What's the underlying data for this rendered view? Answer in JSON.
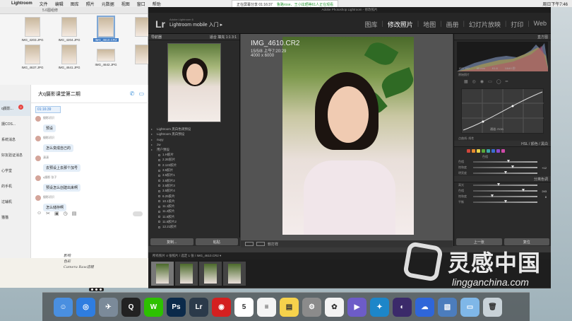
{
  "menubar": {
    "apple": "",
    "app": "Lightroom",
    "items": [
      "文件",
      "编辑",
      "图库",
      "照片",
      "元数据",
      "视图",
      "窗口",
      "帮助"
    ],
    "right": [
      "周日下午7:46"
    ]
  },
  "share_banner": {
    "text": "正在屏幕分享 01:16:37",
    "notice": "鲁路rose、王小炫晒等61人正在观看"
  },
  "finder": {
    "title": "5.6图组修",
    "thumbs": [
      {
        "name": "IMG_4203.JPG",
        "selected": false,
        "landscape": false
      },
      {
        "name": "IMG_4204.JPG",
        "selected": false,
        "landscape": false
      },
      {
        "name": "IMG_4610.CR2",
        "selected": true,
        "landscape": false
      },
      {
        "name": "",
        "selected": false,
        "landscape": false
      },
      {
        "name": "IMG_4637.JPG",
        "selected": false,
        "landscape": false
      },
      {
        "name": "IMG_4641.JPG",
        "selected": false,
        "landscape": false
      },
      {
        "name": "IMG_4642.JPG",
        "selected": false,
        "landscape": true
      },
      {
        "name": "",
        "selected": false,
        "landscape": false
      }
    ]
  },
  "chat": {
    "sidebar": [
      {
        "label": "",
        "badge": ""
      },
      {
        "label": "q摄影...",
        "badge": "2",
        "active": true
      },
      {
        "label": "摄COS...",
        "badge": "",
        "active": false
      },
      {
        "label": "系统消息",
        "badge": ""
      },
      {
        "label": "好友验证消息",
        "badge": ""
      },
      {
        "label": "心学堂",
        "badge": ""
      },
      {
        "label": "的手机",
        "badge": ""
      },
      {
        "label": "过辅机",
        "badge": ""
      },
      {
        "label": "猫猫",
        "badge": ""
      }
    ],
    "title": "大q摄影课堂第二期",
    "live_label": "01:16:39",
    "messages": [
      {
        "who": "摄影初识",
        "text": "预设"
      },
      {
        "who": "摄影初识",
        "text": "怎么变成自己的"
      },
      {
        "who": "潇潇",
        "text": "去预设上去那个加号"
      },
      {
        "who": "q摄影 张子",
        "text": "预设怎么创建出来啊"
      },
      {
        "who": "摄影初识",
        "text": "怎么储存啊"
      }
    ],
    "tools": [
      "☺",
      "✂",
      "▣",
      "◷",
      "▤"
    ],
    "handwriting": [
      "影响",
      "色彩",
      "Camera Raw滤镜"
    ]
  },
  "lightroom": {
    "window_title": "Adobe Photoshop Lightroom - 修改照片",
    "logo": "Lr",
    "brand": "Adobe Lightroom 6",
    "mobile": "Lightroom mobile 入门 ▸",
    "modules": [
      {
        "label": "图库",
        "active": false
      },
      {
        "label": "修改照片",
        "active": true
      },
      {
        "label": "地图",
        "active": false
      },
      {
        "label": "画册",
        "active": false
      },
      {
        "label": "幻灯片放映",
        "active": false
      },
      {
        "label": "打印",
        "active": false
      },
      {
        "label": "Web",
        "active": false
      }
    ],
    "navigator": {
      "label": "导航器",
      "zoom": "适合 填充 1:1 3:1"
    },
    "presets": [
      {
        "label": "Lightroom 黑白色调预设",
        "level": 0
      },
      {
        "label": "Lightroom 黑白预设",
        "level": 0
      },
      {
        "label": "nuyy",
        "level": 0
      },
      {
        "label": "zw",
        "level": 0
      },
      {
        "label": "用户预设",
        "level": 0
      },
      {
        "label": "1.H胶片",
        "level": 1
      },
      {
        "label": "2.2E胶片",
        "level": 1
      },
      {
        "label": "2.122胶片",
        "level": 1
      },
      {
        "label": "3.5胶片",
        "level": 1
      },
      {
        "label": "3.5胶片1",
        "level": 1
      },
      {
        "label": "3.5胶片2",
        "level": 1
      },
      {
        "label": "3.5胶片3",
        "level": 1
      },
      {
        "label": "3.5胶片4",
        "level": 1
      },
      {
        "label": "6.25胶片",
        "level": 1
      },
      {
        "label": "10.1胶片",
        "level": 1
      },
      {
        "label": "11.1胶片",
        "level": 1
      },
      {
        "label": "11.2胶片",
        "level": 1
      },
      {
        "label": "11.6胶片",
        "level": 1
      },
      {
        "label": "11.6胶片2",
        "level": 1
      },
      {
        "label": "12.21胶片",
        "level": 1
      }
    ],
    "left_buttons": [
      "复制...",
      "粘贴"
    ],
    "photo_info": {
      "filename": "IMG_4610.CR2",
      "date": "15/5/8 上午7:20:29",
      "dims": "4000 x 6000"
    },
    "toolbar": {
      "softproof": "软打样"
    },
    "filmstrip": {
      "label": "所有照片 4 张照片 / 选定 1 张 / IMG_4610.CR2 ▾",
      "selected_index": 0,
      "count": 4
    },
    "right": {
      "histogram_label": "直方图",
      "histogram_vals": [
        "ISO 160",
        "85 mm",
        "f/1.8",
        "1/640 秒"
      ],
      "original_label": "原始照片",
      "curve_label": "通道: RGB",
      "point_curve": "点曲线: 线性",
      "hsl_label": "HSL / 颜色 / 黑白",
      "hue_label": "色相",
      "split_label": "分离色调",
      "sliders": [
        {
          "name": "色相",
          "value": "",
          "pos": 0.55
        },
        {
          "name": "饱和度",
          "value": "+12",
          "pos": 0.62
        },
        {
          "name": "明亮度",
          "value": "",
          "pos": 0.5
        },
        {
          "name": "高光",
          "value": "",
          "pos": 0.4
        },
        {
          "name": "色相",
          "value": "243",
          "pos": 0.78
        },
        {
          "name": "饱和度",
          "value": "8",
          "pos": 0.3
        },
        {
          "name": "平衡",
          "value": "",
          "pos": 0.5
        }
      ],
      "buttons": [
        "上一张",
        "复位"
      ]
    }
  },
  "watermark": {
    "cn": "灵感中国",
    "en": "lingganchina.com"
  },
  "dock": [
    {
      "name": "finder",
      "label": "☺",
      "color": "#4a8fe0"
    },
    {
      "name": "safari",
      "label": "◎",
      "color": "#2f7de0"
    },
    {
      "name": "launchpad",
      "label": "✈",
      "color": "#7b8a99"
    },
    {
      "name": "qq",
      "label": "Q",
      "color": "#222222"
    },
    {
      "name": "wechat",
      "label": "W",
      "color": "#2dc100"
    },
    {
      "name": "photoshop",
      "label": "Ps",
      "color": "#0b2a4a"
    },
    {
      "name": "lightroom",
      "label": "Lr",
      "color": "#2b3a4a"
    },
    {
      "name": "netease",
      "label": "◉",
      "color": "#d42020"
    },
    {
      "name": "calendar",
      "label": "5",
      "color": "#ffffff"
    },
    {
      "name": "reminders",
      "label": "≡",
      "color": "#f4f4f4"
    },
    {
      "name": "notes",
      "label": "▤",
      "color": "#f6d24c"
    },
    {
      "name": "settings",
      "label": "⚙",
      "color": "#8b8b8b"
    },
    {
      "name": "photos",
      "label": "✿",
      "color": "#f3f3f3"
    },
    {
      "name": "imovie",
      "label": "▶",
      "color": "#6d5cc8"
    },
    {
      "name": "bird",
      "label": "✦",
      "color": "#1d86c9"
    },
    {
      "name": "video",
      "label": "◐",
      "color": "#3b2a6a"
    },
    {
      "name": "baidu",
      "label": "☁",
      "color": "#2f66d9"
    },
    {
      "name": "preview",
      "label": "▧",
      "color": "#4c7dbd"
    },
    {
      "name": "folder",
      "label": "▭",
      "color": "#7fb7e8"
    },
    {
      "name": "trash",
      "label": "🗑",
      "color": "#c8d2d8"
    }
  ]
}
